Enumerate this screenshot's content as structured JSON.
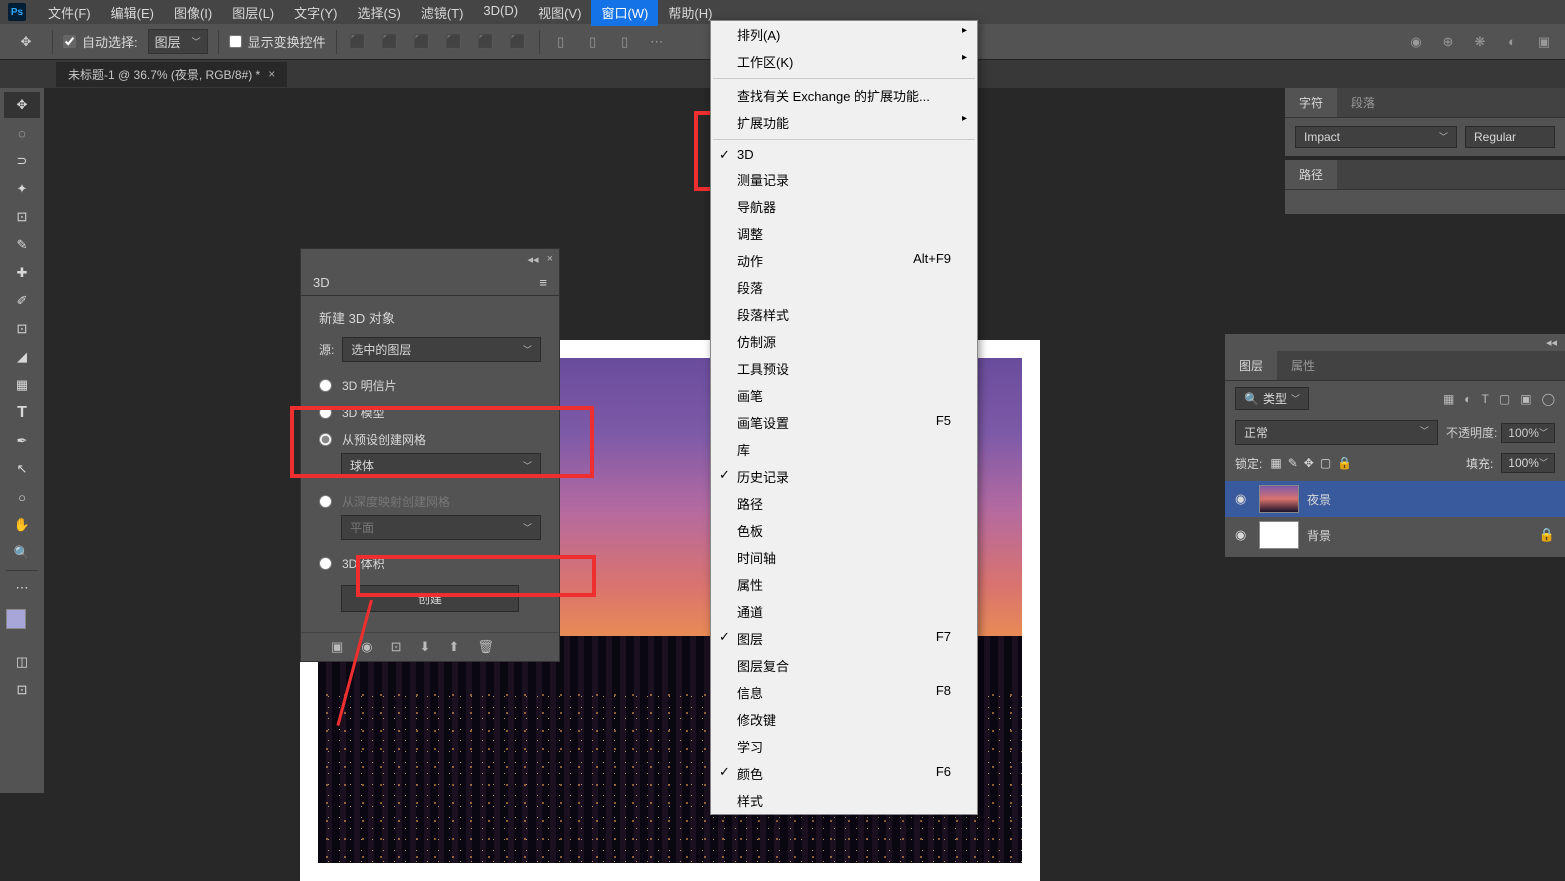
{
  "menubar": {
    "items": [
      "文件(F)",
      "编辑(E)",
      "图像(I)",
      "图层(L)",
      "文字(Y)",
      "选择(S)",
      "滤镜(T)",
      "3D(D)",
      "视图(V)",
      "窗口(W)",
      "帮助(H)"
    ],
    "active_index": 9
  },
  "optionsbar": {
    "autoselect_label": "自动选择:",
    "autoselect_value": "图层",
    "show_transform": "显示变换控件"
  },
  "doctab": {
    "title": "未标题-1 @ 36.7% (夜景, RGB/8#) *"
  },
  "windowmenu": {
    "items": [
      {
        "label": "排列(A)",
        "arrow": true
      },
      {
        "label": "工作区(K)",
        "arrow": true
      },
      {
        "sep": true
      },
      {
        "label": "查找有关 Exchange 的扩展功能..."
      },
      {
        "label": "扩展功能",
        "arrow": true
      },
      {
        "sep": true
      },
      {
        "label": "3D",
        "check": true
      },
      {
        "label": "测量记录"
      },
      {
        "label": "导航器"
      },
      {
        "label": "调整"
      },
      {
        "label": "动作",
        "shortcut": "Alt+F9"
      },
      {
        "label": "段落"
      },
      {
        "label": "段落样式"
      },
      {
        "label": "仿制源"
      },
      {
        "label": "工具预设"
      },
      {
        "label": "画笔"
      },
      {
        "label": "画笔设置",
        "shortcut": "F5"
      },
      {
        "label": "库"
      },
      {
        "label": "历史记录",
        "check": true
      },
      {
        "label": "路径"
      },
      {
        "label": "色板"
      },
      {
        "label": "时间轴"
      },
      {
        "label": "属性"
      },
      {
        "label": "通道"
      },
      {
        "label": "图层",
        "check": true,
        "shortcut": "F7"
      },
      {
        "label": "图层复合"
      },
      {
        "label": "信息",
        "shortcut": "F8"
      },
      {
        "label": "修改键"
      },
      {
        "label": "学习"
      },
      {
        "label": "颜色",
        "check": true,
        "shortcut": "F6"
      },
      {
        "label": "样式"
      }
    ]
  },
  "panel3d": {
    "tab": "3D",
    "title": "新建 3D 对象",
    "source_label": "源:",
    "source_value": "选中的图层",
    "opt_postcard": "3D 明信片",
    "opt_model": "3D 模型",
    "opt_mesh": "从预设创建网格",
    "mesh_value": "球体",
    "opt_depth": "从深度映射创建网格",
    "depth_value": "平面",
    "opt_volume": "3D 体积",
    "create": "创建"
  },
  "char_panel": {
    "tab_char": "字符",
    "tab_para": "段落",
    "font": "Impact",
    "style": "Regular"
  },
  "path_panel": {
    "tab": "路径"
  },
  "layer_panel": {
    "tab_layers": "图层",
    "tab_props": "属性",
    "filter_label": "类型",
    "blend": "正常",
    "opacity_label": "不透明度:",
    "opacity": "100%",
    "lock_label": "锁定:",
    "fill_label": "填充:",
    "fill": "100%",
    "layers": [
      {
        "name": "夜景",
        "sel": true,
        "night": true
      },
      {
        "name": "背景",
        "lock": true
      }
    ]
  }
}
